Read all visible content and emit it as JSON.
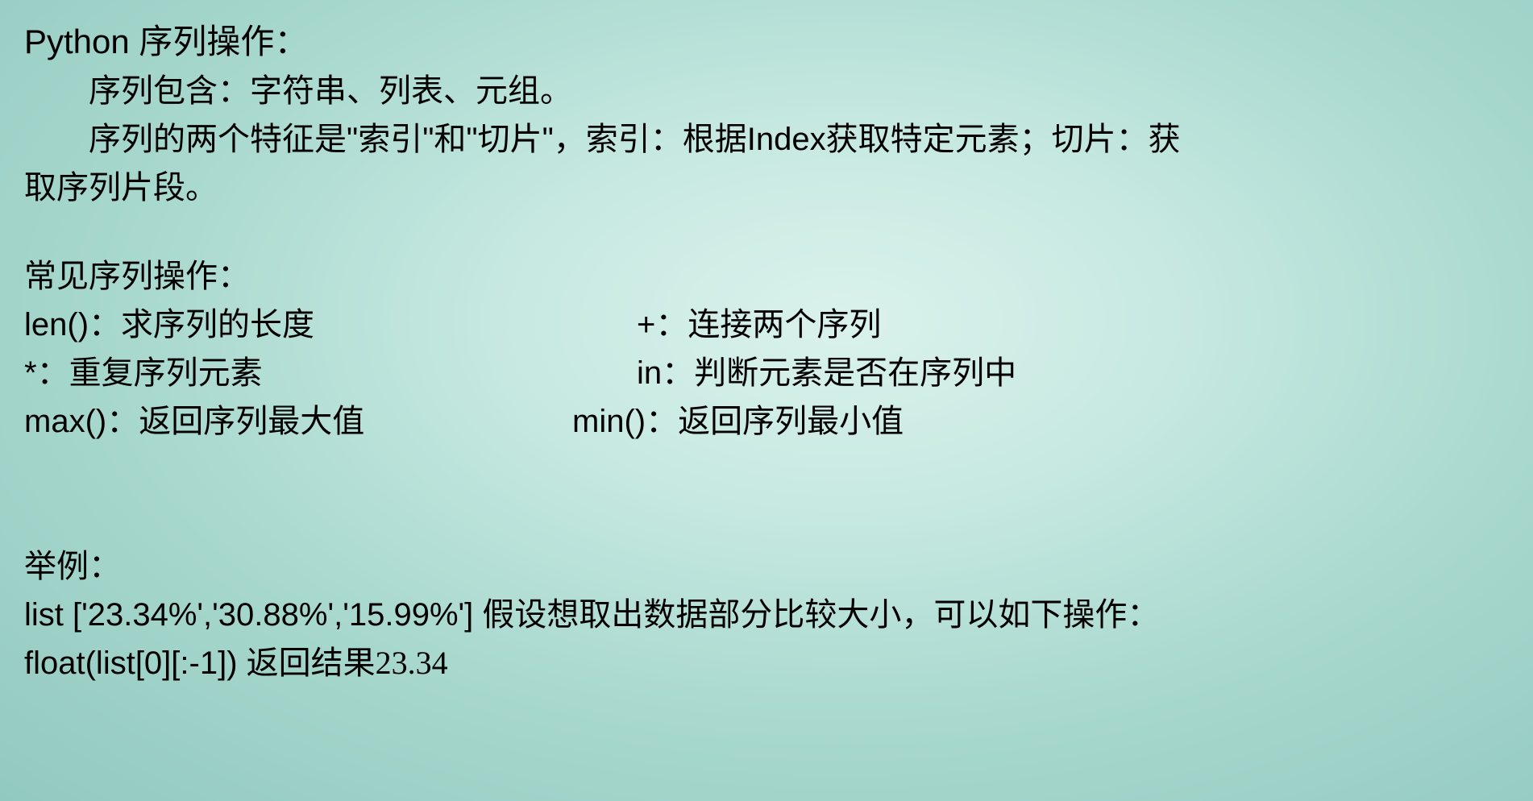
{
  "title": "Python 序列操作：",
  "intro": {
    "line1": "序列包含：字符串、列表、元组。",
    "line2a": "序列的两个特征是\"索引\"和\"切片\"，索引：根据Index获取特定元素；切片：获",
    "line3": "取序列片段。"
  },
  "opsHeader": "常见序列操作：",
  "ops": {
    "r1l": "len()：求序列的长度",
    "r1r": "+：连接两个序列",
    "r2l": "*：重复序列元素",
    "r2r": "in：判断元素是否在序列中",
    "r3l": "max()：返回序列最大值",
    "r3r_pre": "min()",
    "r3r_post": "：返回序列最小值"
  },
  "example": {
    "label": "举例：",
    "line1_code": "list  ['23.34%','30.88%','15.99%']  ",
    "line1_text": "假设想取出数据部分比较大小，可以如下操作：",
    "line2_code": "float(list[0][:-1])   ",
    "line2_text": "返回结果23.34"
  }
}
